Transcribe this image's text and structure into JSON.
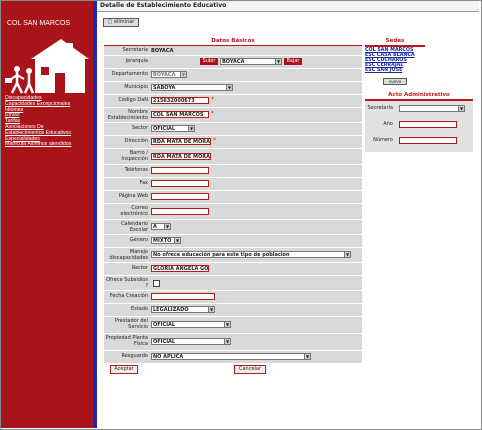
{
  "sidebar": {
    "institution_name": "COL SAN MARCOS",
    "links": [
      "Discapacidades",
      "Capacidades Excepcionales",
      "Idiomas",
      "Etnias",
      "Tarifas",
      "Asociaciones De Establecimientos Educativos",
      "Especialidades",
      "Matricula Alumnos atendidos"
    ]
  },
  "header": {
    "title": "Detalle de Establecimiento Educativo",
    "delete_button": "eliminar"
  },
  "form": {
    "title": "Datos Básicos",
    "secretaria": {
      "label": "Secretaría",
      "value": "BOYACA"
    },
    "jerarquia": {
      "label": "Jerarquía",
      "up_button": "Subir",
      "value": "BOYACA",
      "down_button": "Bajar"
    },
    "departamento": {
      "label": "Departamento",
      "value": "BOYACA"
    },
    "municipio": {
      "label": "Municipio",
      "value": "SABOYÁ"
    },
    "codigo_dane": {
      "label": "Código DaN",
      "value": "215632000673"
    },
    "nombre": {
      "label": "Nombre Establecimiento",
      "value": "COL SAN MARCOS"
    },
    "sector": {
      "label": "Sector",
      "value": "OFICIAL"
    },
    "direccion": {
      "label": "Dirección",
      "value": "RDA MATA DE MORA"
    },
    "barrio": {
      "label": "Barrio / Inspección",
      "value": "RDA MATA DE MORA"
    },
    "telefonos": {
      "label": "Teléfonos",
      "value": ""
    },
    "fax": {
      "label": "Fax",
      "value": ""
    },
    "pagina_web": {
      "label": "Página Web",
      "value": ""
    },
    "correo": {
      "label": "Correo electrónico",
      "value": ""
    },
    "calendario": {
      "label": "Calendario Escolar",
      "value": "A"
    },
    "genero": {
      "label": "Género",
      "value": "MIXTO"
    },
    "discapacidad": {
      "label": "Manejo discapacidades",
      "value": "No ofrece educación para este tipo de población"
    },
    "rector": {
      "label": "Rector",
      "value": "GLORIA ANGELA GON"
    },
    "subsidios": {
      "label": "Ofrece Subsidios ?"
    },
    "fecha_creacion": {
      "label": "Fecha Creación",
      "value": ""
    },
    "estado": {
      "label": "Estado",
      "value": "LEGALIZADO"
    },
    "prestador": {
      "label": "Prestador del Servicio",
      "value": "OFICIAL"
    },
    "propiedad": {
      "label": "Propiedad Planta Física",
      "value": "OFICIAL"
    },
    "resguardo": {
      "label": "Resguardo",
      "value": "NO APLICA"
    },
    "accept_button": "Aceptar",
    "cancel_button": "Cancelar"
  },
  "sedes": {
    "title": "Sedes",
    "items": [
      "COL SAN MARCOS",
      "ESC CASA BLANCA",
      "ESC CUCHAROS",
      "ESC CERRAJAL",
      "ESC SAN JOSE"
    ],
    "new_button": "nuevo"
  },
  "acto": {
    "title": "Acto Administrativo",
    "secretaria_label": "Secretaría",
    "anio_label": "Año",
    "numero_label": "Número"
  }
}
